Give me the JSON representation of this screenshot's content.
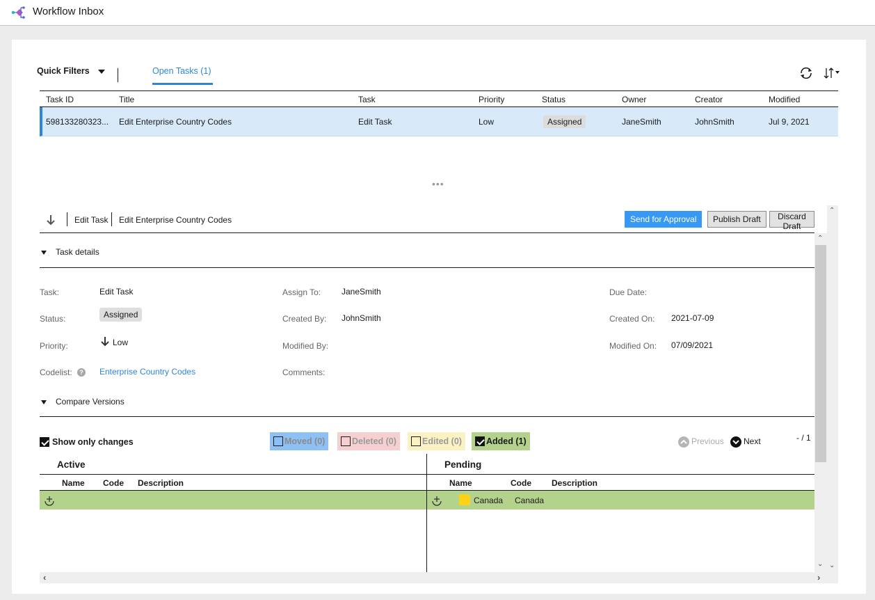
{
  "app": {
    "title": "Workflow Inbox",
    "logo_icon": "workflow-logo-icon"
  },
  "toolbar": {
    "quick_filters_label": "Quick Filters",
    "tabs": [
      {
        "label": "Open Tasks (1)",
        "active": true
      }
    ],
    "refresh_icon": "refresh-icon",
    "sort_icon": "sort-icon"
  },
  "task_table": {
    "columns": [
      "Task ID",
      "Title",
      "Task",
      "Priority",
      "Status",
      "Owner",
      "Creator",
      "Modified"
    ],
    "rows": [
      {
        "task_id": "598133280323...",
        "title": "Edit Enterprise Country Codes",
        "task": "Edit Task",
        "priority": "Low",
        "status": "Assigned",
        "owner": "JaneSmith",
        "creator": "JohnSmith",
        "modified": "Jul 9, 2021",
        "selected": true
      }
    ]
  },
  "splitter": {
    "label": "•••"
  },
  "detail": {
    "task_type": "Edit Task",
    "task_title": "Edit Enterprise Country Codes",
    "buttons": {
      "send": "Send for Approval",
      "publish": "Publish Draft",
      "discard": "Discard Draft"
    },
    "section_task_details": "Task details",
    "fields": {
      "task": {
        "label": "Task:",
        "value": "Edit Task"
      },
      "status": {
        "label": "Status:",
        "value": "Assigned"
      },
      "priority": {
        "label": "Priority:",
        "value": "Low"
      },
      "codelist": {
        "label": "Codelist:",
        "value": "Enterprise Country Codes"
      },
      "assign_to": {
        "label": "Assign To:",
        "value": "JaneSmith"
      },
      "created_by": {
        "label": "Created By:",
        "value": "JohnSmith"
      },
      "modified_by": {
        "label": "Modified By:",
        "value": ""
      },
      "comments": {
        "label": "Comments:",
        "value": ""
      },
      "due_date": {
        "label": "Due Date:",
        "value": ""
      },
      "created_on": {
        "label": "Created On:",
        "value": "2021-07-09"
      },
      "modified_on": {
        "label": "Modified On:",
        "value": "07/09/2021"
      }
    },
    "section_compare": "Compare Versions"
  },
  "compare": {
    "show_only_changes": {
      "label": "Show only changes",
      "checked": true
    },
    "legend": [
      {
        "key": "moved",
        "label": "Moved (0)",
        "checked": false,
        "color": "#8dc0f4"
      },
      {
        "key": "deleted",
        "label": "Deleted (0)",
        "checked": false,
        "color": "#f6cfd1"
      },
      {
        "key": "edited",
        "label": "Edited (0)",
        "checked": false,
        "color": "#fbf2c4"
      },
      {
        "key": "added",
        "label": "Added (1)",
        "checked": true,
        "color": "#b3d28b"
      }
    ],
    "previous_label": "Previous",
    "next_label": "Next",
    "page_count": "- / 1",
    "active": {
      "title": "Active",
      "columns": [
        "Name",
        "Code",
        "Description"
      ],
      "rows": [
        {
          "name": "",
          "code": "",
          "description": ""
        }
      ]
    },
    "pending": {
      "title": "Pending",
      "columns": [
        "Name",
        "Code",
        "Description"
      ],
      "rows": [
        {
          "name": "Canada",
          "code": "Canada",
          "description": ""
        }
      ]
    }
  }
}
